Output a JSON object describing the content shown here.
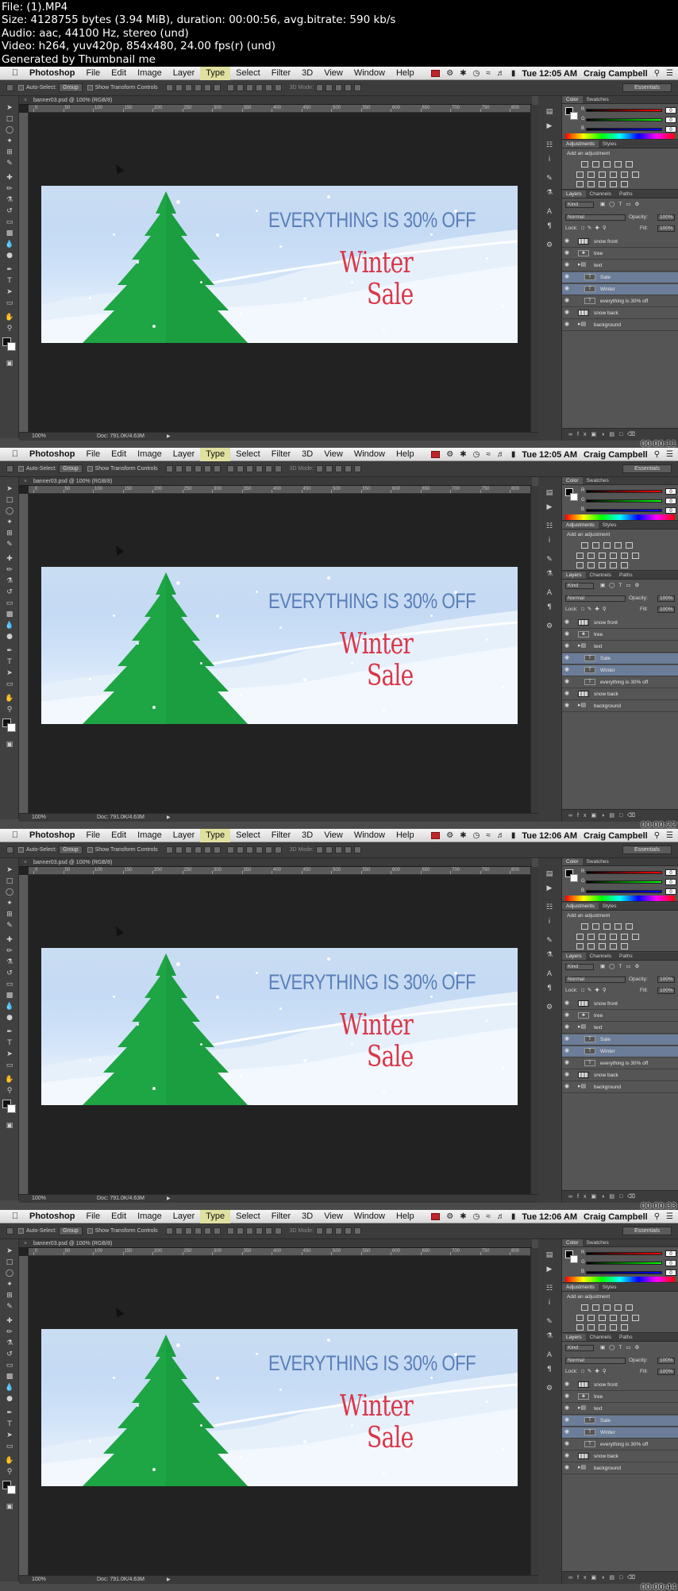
{
  "header": {
    "line1": "File:  (1).MP4",
    "line2": "Size: 4128755 bytes (3.94 MiB), duration: 00:00:56, avg.bitrate: 590 kb/s",
    "line3": "Audio: aac, 44100 Hz, stereo (und)",
    "line4": "Video: h264, yuv420p, 854x480, 24.00 fps(r) (und)",
    "line5": "Generated by Thumbnail me"
  },
  "frames": [
    {
      "clock": "Tue 12:05 AM",
      "timecode": "00:00:11"
    },
    {
      "clock": "Tue 12:05 AM",
      "timecode": "00:00:22"
    },
    {
      "clock": "Tue 12:06 AM",
      "timecode": "00:00:33"
    },
    {
      "clock": "Tue 12:06 AM",
      "timecode": "00:00:44"
    }
  ],
  "menubar": {
    "app": "Photoshop",
    "items": [
      "File",
      "Edit",
      "Image",
      "Layer",
      "Type",
      "Select",
      "Filter",
      "3D",
      "View",
      "Window",
      "Help"
    ],
    "user": "Craig Campbell"
  },
  "options": {
    "auto_select": "Auto-Select:",
    "group": "Group",
    "show_transform": "Show Transform Controls",
    "mode_3d": "3D Mode:",
    "workspace": "Essentials"
  },
  "document": {
    "tab": "banner03.psd @ 100% (RGB/8)",
    "zoom": "100%",
    "doc_size": "Doc: 791.0K/4.63M",
    "ruler_ticks": [
      "0",
      "50",
      "100",
      "150",
      "200",
      "250",
      "300",
      "350",
      "400",
      "450",
      "500",
      "550",
      "600",
      "650",
      "700",
      "750",
      "800"
    ]
  },
  "banner": {
    "headline": "EVERYTHING IS 30% OFF",
    "word1": "Winter",
    "word2": "Sale",
    "tree_color": "#1ea544",
    "headline_color": "#5a7fb8",
    "script_color": "#d9374a"
  },
  "color_panel": {
    "tabs": [
      "Color",
      "Swatches"
    ],
    "r": "R",
    "g": "G",
    "b": "B",
    "r_val": "0",
    "g_val": "0",
    "b_val": "0"
  },
  "adjustments_panel": {
    "tabs": [
      "Adjustments",
      "Styles"
    ],
    "title": "Add an adjustment"
  },
  "layers_panel": {
    "tabs": [
      "Layers",
      "Channels",
      "Paths"
    ],
    "kind": "Kind",
    "blend": "Normal",
    "opacity_label": "Opacity:",
    "opacity": "100%",
    "lock_label": "Lock:",
    "fill_label": "Fill:",
    "fill": "100%",
    "layers": [
      {
        "name": "snow front",
        "type": "raster",
        "selected": false,
        "indent": 0
      },
      {
        "name": "tree",
        "type": "smart",
        "selected": false,
        "indent": 0
      },
      {
        "name": "text",
        "type": "folder",
        "selected": false,
        "indent": 0
      },
      {
        "name": "Sale",
        "type": "text",
        "selected": true,
        "indent": 1
      },
      {
        "name": "Winter",
        "type": "text",
        "selected": true,
        "indent": 1
      },
      {
        "name": "everything is 30% off",
        "type": "text",
        "selected": false,
        "indent": 1
      },
      {
        "name": "snow back",
        "type": "raster",
        "selected": false,
        "indent": 0
      },
      {
        "name": "background",
        "type": "folder",
        "selected": false,
        "indent": 0
      }
    ]
  },
  "icons": {
    "apple": "apple-icon",
    "wifi": "wifi-icon",
    "search": "search-icon",
    "menu": "menu-list-icon"
  }
}
